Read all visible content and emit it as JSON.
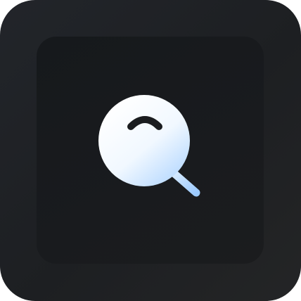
{
  "app": {
    "name": "Search",
    "icon": "magnifying-glass-icon"
  },
  "colors": {
    "outer_background": "#1f2124",
    "inner_tile": "#17191c",
    "glass_top": "#ffffff",
    "glass_bottom": "#b9dbff",
    "handle": "#a9d2ff",
    "eye_stroke": "#1a1c1f"
  }
}
